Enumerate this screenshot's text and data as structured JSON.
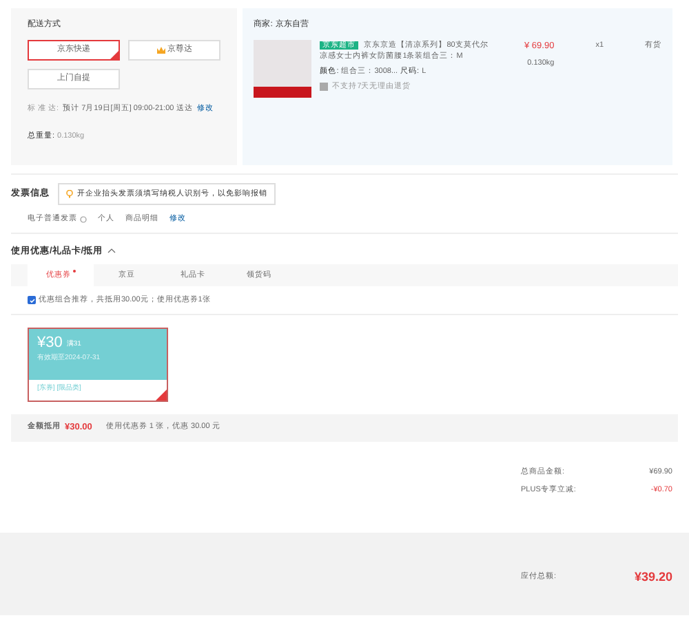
{
  "delivery": {
    "title": "配送方式",
    "options": [
      {
        "label": "京东快递",
        "selected": true,
        "kind": "plain"
      },
      {
        "label": "京尊达",
        "selected": false,
        "kind": "crown"
      },
      {
        "label": "上门自提",
        "selected": false,
        "kind": "plain"
      }
    ],
    "schedule_label": "标 准 达:",
    "schedule": "预计 7月19日[周五] 09:00-21:00 送达",
    "schedule_link": "修改",
    "weight_label": "总重量:",
    "weight": "0.130kg"
  },
  "seller": {
    "label": "商家:",
    "name": "京东自营",
    "product": {
      "tag": "京东超市",
      "title": "京东京造【清凉系列】80支莫代尔凉感女士内裤女防菌腰1条装组合三：M",
      "specs_label1": "颜色:",
      "specs_value1": "组合三：3008...",
      "specs_label2": "尺码:",
      "specs_value2": "L",
      "notice": "不支持7天无理由退货",
      "price": "¥ 69.90",
      "weight": "0.130kg",
      "qty": "x1",
      "stock": "有货"
    }
  },
  "invoice": {
    "title": "发票信息",
    "tip": "开企业抬头发票须填写纳税人识别号，以免影响报销",
    "type": "电子普通发票",
    "holder": "个人",
    "content": "商品明细",
    "edit": "修改"
  },
  "discounts": {
    "title": "使用优惠/礼品卡/抵用",
    "expanded": true,
    "tabs": [
      {
        "label": "优惠券",
        "selected": true,
        "dot": true
      },
      {
        "label": "京豆",
        "selected": false,
        "dot": false
      },
      {
        "label": "礼品卡",
        "selected": false,
        "dot": false
      },
      {
        "label": "领货码",
        "selected": false,
        "dot": false
      }
    ],
    "recommend": {
      "checked": true,
      "text": "优惠组合推荐，共抵用30.00元；使用优惠券1张"
    },
    "coupon": {
      "amount": "¥30",
      "condition": "满31",
      "validity": "有效期至2024-07-31",
      "tags": "[东券] [限品类]",
      "selected": true
    },
    "summary_label": "金额抵用",
    "summary_amount": "¥30.00",
    "summary_text": "使用优惠券 1 张，优惠 30.00 元"
  },
  "totals": [
    {
      "label": "总商品金额:",
      "value": "¥69.90",
      "kind": "normal"
    },
    {
      "label": "PLUS专享立减:",
      "value": "-¥0.70",
      "kind": "discount"
    }
  ],
  "payable": {
    "label": "应付总额:",
    "value": "¥39.20"
  }
}
